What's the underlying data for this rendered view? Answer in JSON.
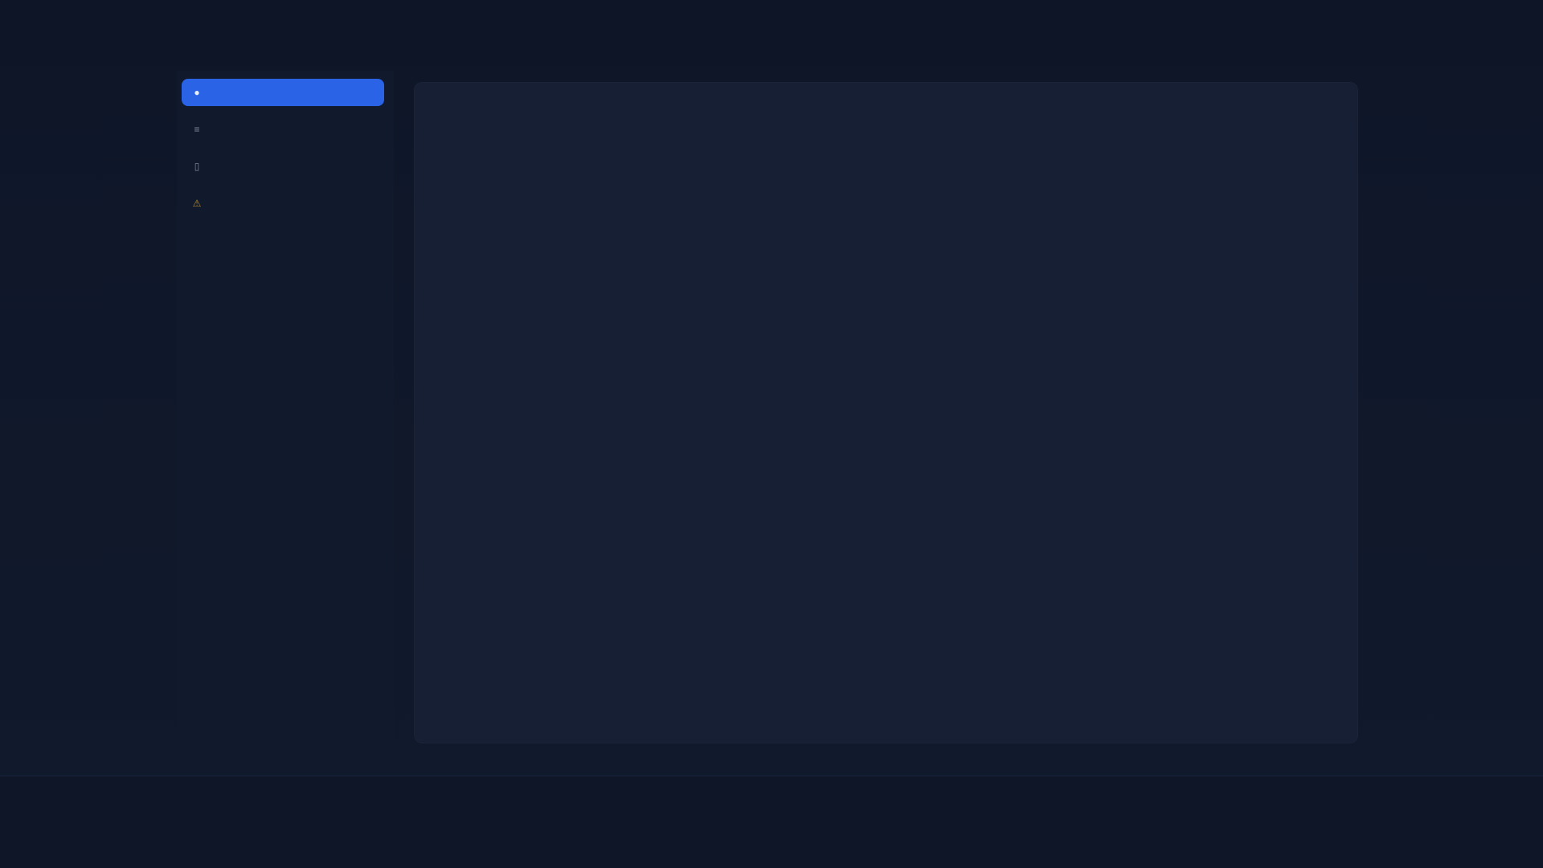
{
  "sidebar": {
    "items": [
      {
        "label": "",
        "icon": "home-icon",
        "state": "active"
      },
      {
        "label": "",
        "icon": "list-icon",
        "state": "normal"
      },
      {
        "label": "",
        "icon": "folder-icon",
        "state": "normal"
      },
      {
        "label": "",
        "icon": "warning-icon",
        "state": "warning"
      }
    ]
  },
  "footer": {
    "lines": [
      "",
      "",
      ""
    ]
  },
  "colors": {
    "accent": "#2b63e6",
    "warning": "#b58a2a",
    "background": "#0f1729",
    "panel": "#161f33"
  }
}
